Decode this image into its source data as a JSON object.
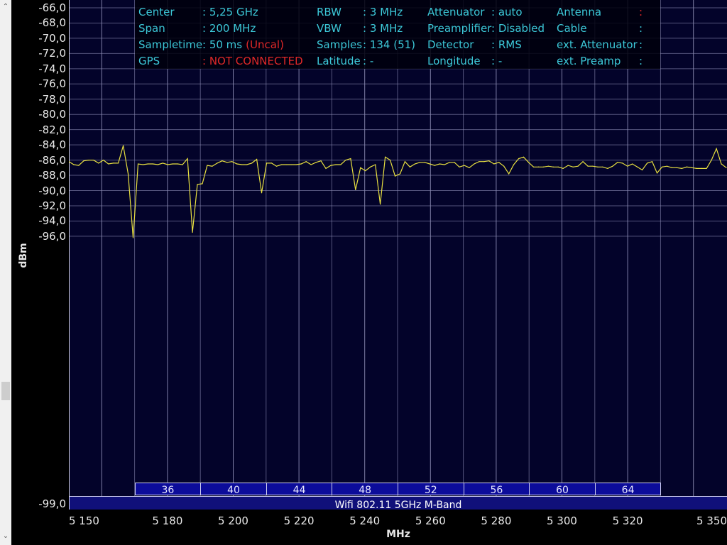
{
  "info": {
    "rows": [
      [
        {
          "label": "Center",
          "value": "5,25 GHz"
        },
        {
          "label": "RBW",
          "value": "3 MHz"
        },
        {
          "label": "Attenuator",
          "value": "auto"
        },
        {
          "label": "Antenna",
          "value": ""
        }
      ],
      [
        {
          "label": "Span",
          "value": "200 MHz"
        },
        {
          "label": "VBW",
          "value": "3 MHz"
        },
        {
          "label": "Preamplifier",
          "value": "Disabled"
        },
        {
          "label": "Cable",
          "value": ""
        }
      ],
      [
        {
          "label": "Sampletime",
          "value": "50 ms",
          "extra": "(Uncal)"
        },
        {
          "label": "Samples",
          "value": "134 (51)"
        },
        {
          "label": "Detector",
          "value": "RMS"
        },
        {
          "label": "ext. Attenuator",
          "value": ""
        }
      ],
      [
        {
          "label": "GPS",
          "value": "NOT CONNECTED"
        },
        {
          "label": "Latitude",
          "value": "-"
        },
        {
          "label": "Longitude",
          "value": "-"
        },
        {
          "label": "ext. Preamp",
          "value": ""
        }
      ]
    ]
  },
  "channels": [
    "36",
    "40",
    "44",
    "48",
    "52",
    "56",
    "60",
    "64"
  ],
  "band_label": "Wifi 802.11 5GHz M-Band",
  "colors": {
    "trace": "#e8e040",
    "text": "#3cc8d8",
    "alert": "#e02828",
    "plot_bg": "#03032a",
    "grid": "#8c8cb4"
  },
  "chart_data": {
    "type": "line",
    "xlabel": "MHz",
    "ylabel": "dBm",
    "xlim": [
      5150,
      5350
    ],
    "ylim": [
      -99,
      -66
    ],
    "grid": true,
    "x_ticks": [
      "5 150",
      "5 180",
      "5 200",
      "5 220",
      "5 240",
      "5 260",
      "5 280",
      "5 300",
      "5 320",
      "5 350"
    ],
    "y_ticks": [
      "-66,0",
      "-68,0",
      "-70,0",
      "-72,0",
      "-74,0",
      "-76,0",
      "-78,0",
      "-80,0",
      "-82,0",
      "-84,0",
      "-86,0",
      "-88,0",
      "-90,0",
      "-92,0",
      "-94,0",
      "-96,0",
      "-99,0"
    ],
    "series": [
      {
        "x_start": 5150,
        "x_stop": 5350,
        "values": [
          -86.2,
          -86.6,
          -86.7,
          -86.1,
          -86.0,
          -86.0,
          -86.4,
          -86.0,
          -86.5,
          -86.4,
          -86.4,
          -84.1,
          -87.8,
          -96.2,
          -86.5,
          -86.6,
          -86.5,
          -86.5,
          -86.6,
          -86.4,
          -86.6,
          -86.5,
          -86.5,
          -86.6,
          -85.8,
          -95.5,
          -89.2,
          -89.1,
          -86.7,
          -86.8,
          -86.4,
          -86.1,
          -86.3,
          -86.2,
          -86.5,
          -86.6,
          -86.6,
          -86.4,
          -85.9,
          -90.3,
          -86.4,
          -86.4,
          -86.8,
          -86.6,
          -86.6,
          -86.6,
          -86.6,
          -86.5,
          -86.2,
          -86.6,
          -86.3,
          -86.1,
          -87.1,
          -86.7,
          -86.6,
          -86.6,
          -86.0,
          -85.8,
          -89.9,
          -87.0,
          -87.4,
          -86.9,
          -86.6,
          -91.8,
          -85.6,
          -86.0,
          -88.1,
          -87.8,
          -86.2,
          -86.9,
          -86.5,
          -86.3,
          -86.3,
          -86.5,
          -86.7,
          -86.5,
          -86.6,
          -86.3,
          -86.3,
          -86.9,
          -86.7,
          -87.0,
          -86.5,
          -86.2,
          -86.2,
          -86.1,
          -86.5,
          -86.3,
          -86.8,
          -87.8,
          -86.6,
          -85.8,
          -85.6,
          -86.3,
          -86.9,
          -86.9,
          -86.9,
          -86.8,
          -86.9,
          -86.9,
          -87.1,
          -86.7,
          -86.9,
          -86.8,
          -86.2,
          -86.8,
          -86.8,
          -86.9,
          -86.9,
          -87.1,
          -86.8,
          -86.3,
          -86.4,
          -86.8,
          -86.5,
          -86.9,
          -87.3,
          -86.4,
          -86.2,
          -87.7,
          -86.9,
          -86.8,
          -87.0,
          -87.0,
          -87.1,
          -86.9,
          -87.0,
          -87.1,
          -87.1,
          -87.1,
          -86.0,
          -84.5,
          -86.5,
          -87.0
        ]
      }
    ]
  }
}
